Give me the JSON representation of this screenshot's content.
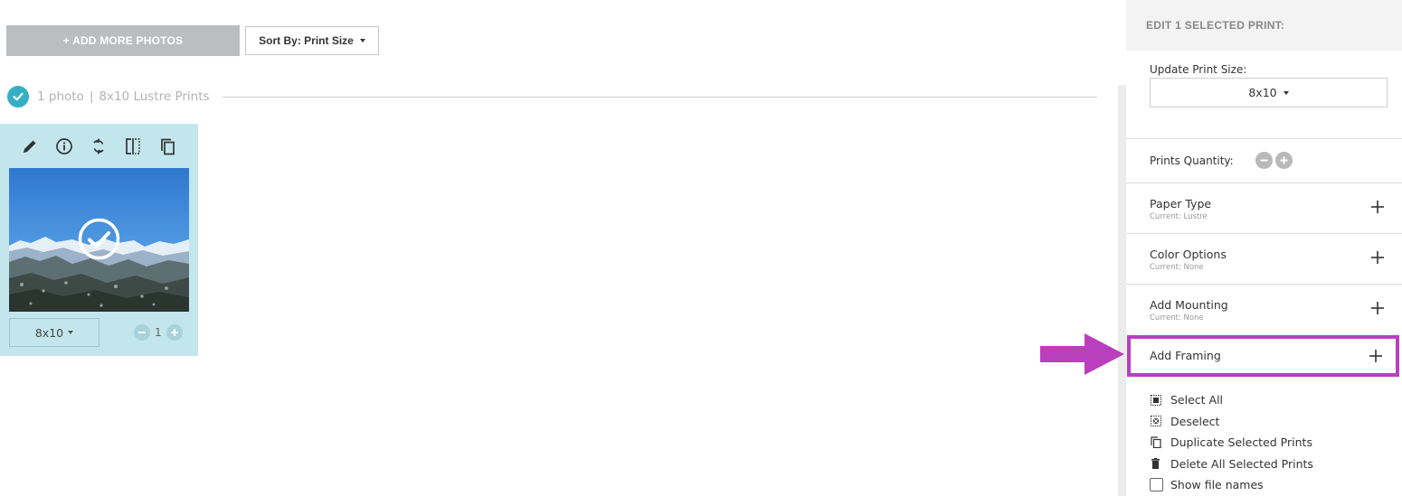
{
  "toolbar": {
    "add_photos_label": "+ ADD MORE PHOTOS",
    "sort_label": "Sort By: Print Size"
  },
  "group": {
    "count": "1 photo",
    "separator": "|",
    "product": "8x10 Lustre Prints"
  },
  "card": {
    "tools": [
      "pencil-icon",
      "info-icon",
      "rotate-icon",
      "mirror-icon",
      "duplicate-icon"
    ],
    "size": "8x10",
    "quantity": "1"
  },
  "panel": {
    "header": "EDIT 1 SELECTED PRINT:",
    "update_size_label": "Update Print Size:",
    "update_size_value": "8x10",
    "prints_quantity_label": "Prints Quantity:",
    "options": [
      {
        "title": "Paper Type",
        "current": "Current: Lustre"
      },
      {
        "title": "Color Options",
        "current": "Current: None"
      },
      {
        "title": "Add Mounting",
        "current": "Current: None"
      }
    ],
    "framing_label": "Add Framing",
    "actions": {
      "select_all": "Select All",
      "deselect": "Deselect",
      "duplicate": "Duplicate Selected Prints",
      "delete": "Delete All Selected Prints",
      "show_names": "Show file names"
    }
  },
  "colors": {
    "accent_teal": "#36afc4",
    "card_bg": "#c3e6ec",
    "highlight_magenta": "#b93fbf"
  }
}
